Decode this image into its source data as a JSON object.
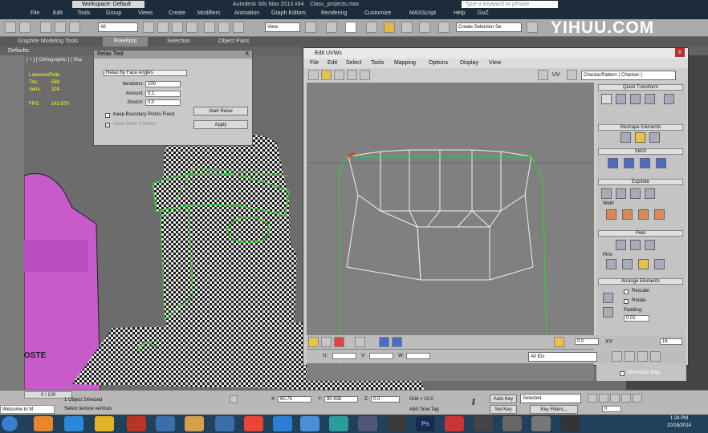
{
  "app": {
    "workspace": "Workspace: Default",
    "title": "Autodesk 3ds Max  2013 x64",
    "file": "Class_projects.max",
    "search_placeholder": "Type a keyword or phrase",
    "logo": "YIHUU.COM"
  },
  "menu": [
    "File",
    "Edit",
    "Tools",
    "Group",
    "Views",
    "Create",
    "Modifiers",
    "Animation",
    "Graph Editors",
    "Rendering",
    "Customize",
    "MAXScript",
    "Help",
    "GoZ"
  ],
  "toolbar": {
    "filter": "All",
    "view": "View",
    "selection_set": "Create Selection Se"
  },
  "ribbon": {
    "tabs": [
      "Graphite Modeling Tools",
      "Freeform",
      "Selection",
      "Object Paint"
    ],
    "active": "Freeform",
    "defaults": "Defaults:"
  },
  "viewport": {
    "label": "[ + ] [ Orthographic ] [ Sha",
    "object_name": "LaurencePolle",
    "stats": [
      {
        "label": "Tris:",
        "value": "568"
      },
      {
        "label": "Verts:",
        "value": "324"
      },
      {
        "label": "FPS:",
        "value": "143.970"
      }
    ],
    "pink_text": [
      "OSTE"
    ]
  },
  "relax_tool": {
    "title": "Relax Tool",
    "close": "X",
    "method": "Relax By Face Angles",
    "iterations_label": "Iterations:",
    "iterations": "100",
    "amount_label": "Amount:",
    "amount": "0.1",
    "stretch_label": "Stretch:",
    "stretch": "0.0",
    "start_button": "Start Relax",
    "apply_button": "Apply",
    "keep_boundary": "Keep Boundary Points Fixed",
    "save_outer": "Save Outer Corners"
  },
  "edit_uvws": {
    "title": "Edit UVWs",
    "menu": [
      "File",
      "Edit",
      "Select",
      "Tools",
      "Mapping",
      "Options",
      "Display",
      "View"
    ],
    "uv_label": "UV",
    "checker": "CheckerPattern  ( Checker )",
    "panel": {
      "quick_transform": "Quick Transform",
      "reshape": "Reshape Elements",
      "stitch": "Stitch",
      "explode": "Explode",
      "weld": "Weld",
      "peel": "Peel",
      "pins": "Pins",
      "arrange": "Arrange Elements",
      "rescale": "Rescale",
      "rotate": "Rotate",
      "padding_label": "Padding:",
      "padding": "0.02",
      "normalize": "Normalize Map"
    },
    "bottom": {
      "u_label": "U:",
      "v_label": "V:",
      "w_label": "W:",
      "xy": "XY",
      "value1": "0.0",
      "value2": "16",
      "all_ids": "All IDs"
    }
  },
  "status": {
    "selection": "1 Object Selected",
    "prompt": "Select texture vertices",
    "frames": "0 / 100",
    "x_label": "X:",
    "x": "60.75",
    "y_label": "Y:",
    "y": "90.938",
    "z_label": "Z:",
    "z": "0.0",
    "grid": "Grid = 10.0",
    "add_time_tag": "Add Time Tag",
    "auto_key": "Auto Key",
    "set_key": "Set Key",
    "selected": "Selected",
    "key_filters": "Key Filters...",
    "frame_value": "0",
    "welcome": "Welcome to M"
  },
  "taskbar": {
    "time": "1:24 PM",
    "date": "10/18/2014"
  }
}
